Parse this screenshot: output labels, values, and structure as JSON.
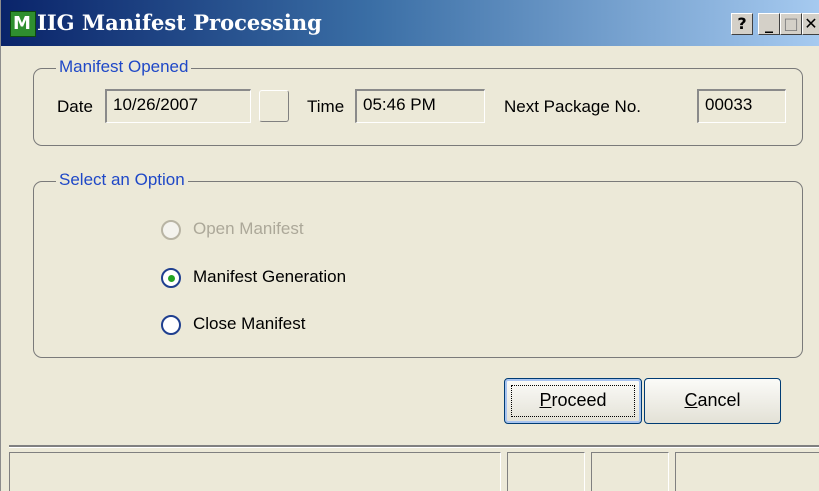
{
  "window": {
    "title": "IIG Manifest Processing"
  },
  "titlebar_buttons": {
    "help": "?",
    "minimize": "_",
    "maximize": "□",
    "close": "✕"
  },
  "manifest_opened": {
    "legend": "Manifest Opened",
    "date_label": "Date",
    "date_value": "10/26/2007",
    "time_label": "Time",
    "time_value": "05:46 PM",
    "next_package_label": "Next Package No.",
    "next_package_value": "00033"
  },
  "select_option": {
    "legend": "Select an Option",
    "options": [
      {
        "label": "Open Manifest",
        "enabled": false,
        "selected": false
      },
      {
        "label": "Manifest Generation",
        "enabled": true,
        "selected": true
      },
      {
        "label": "Close Manifest",
        "enabled": true,
        "selected": false
      }
    ]
  },
  "buttons": {
    "proceed_mnemonic": "P",
    "proceed_rest": "roceed",
    "cancel_mnemonic": "C",
    "cancel_rest": "ancel"
  },
  "colors": {
    "legend_text": "#1f48c7",
    "window_bg": "#ece9d8",
    "title_start": "#0a246a",
    "title_end": "#a6caf0"
  }
}
